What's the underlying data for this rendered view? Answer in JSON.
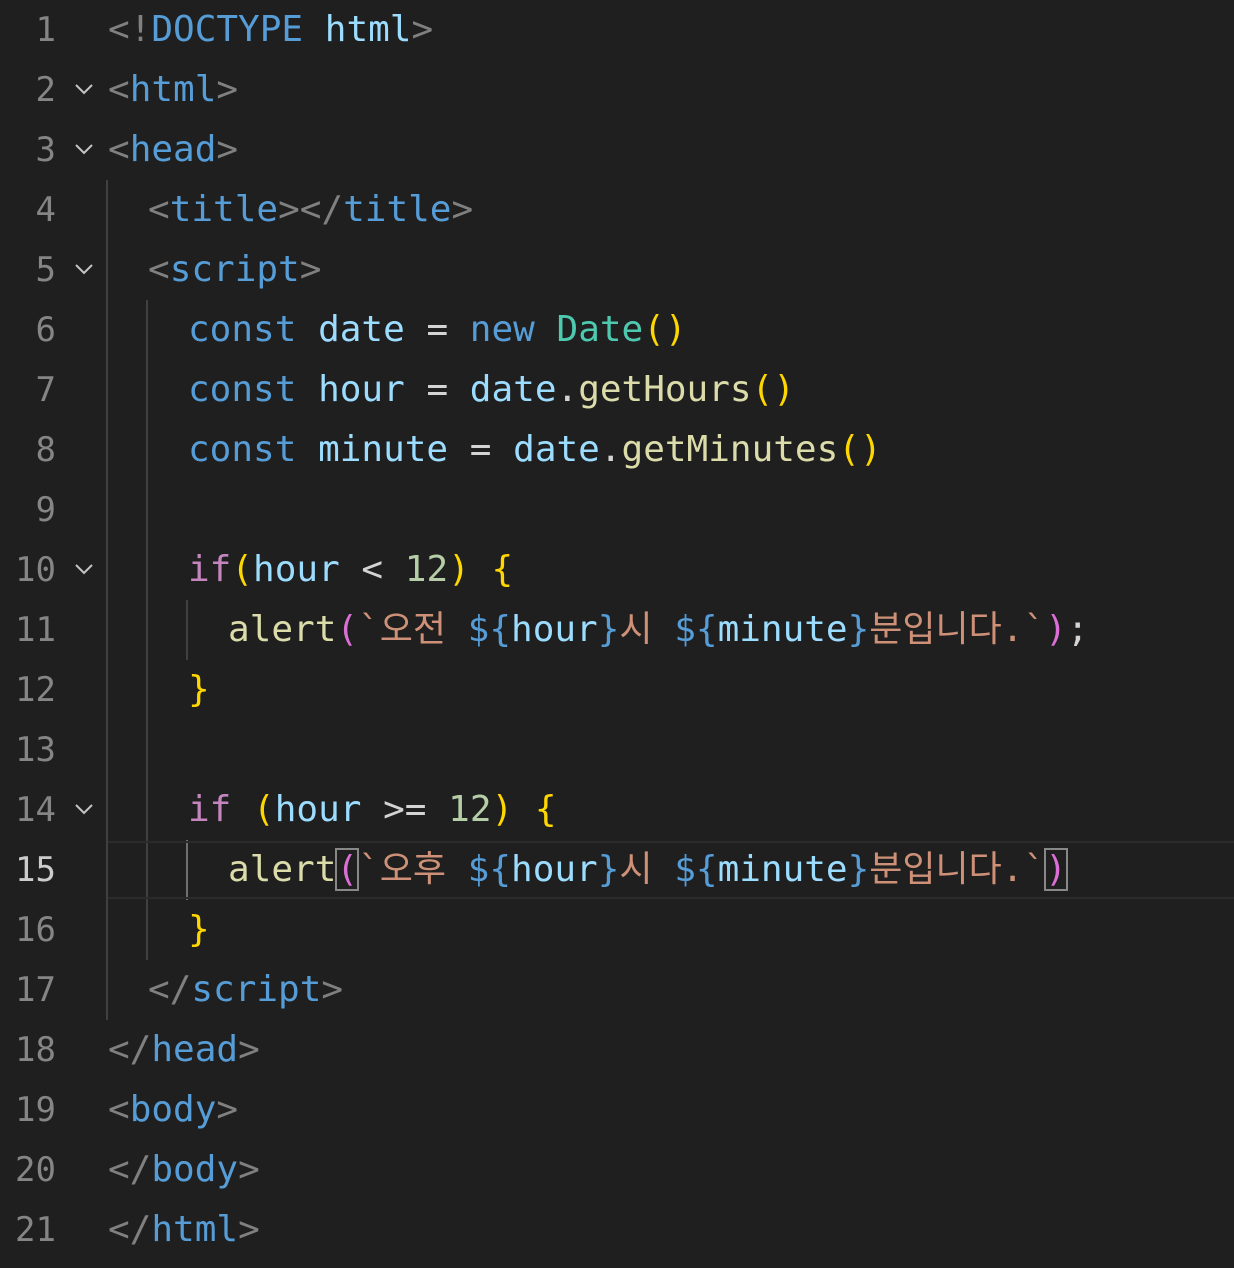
{
  "editor": {
    "active_line": 15,
    "lines": [
      {
        "number": "1",
        "tokens": [
          {
            "t": "<!",
            "c": "pun"
          },
          {
            "t": "DOCTYPE",
            "c": "tag"
          },
          {
            "t": " ",
            "c": "txt"
          },
          {
            "t": "html",
            "c": "attr"
          },
          {
            "t": ">",
            "c": "pun"
          }
        ]
      },
      {
        "number": "2",
        "tokens": [
          {
            "t": "<",
            "c": "pun"
          },
          {
            "t": "html",
            "c": "tag"
          },
          {
            "t": ">",
            "c": "pun"
          }
        ]
      },
      {
        "number": "3",
        "tokens": [
          {
            "t": "<",
            "c": "pun"
          },
          {
            "t": "head",
            "c": "tag"
          },
          {
            "t": ">",
            "c": "pun"
          }
        ]
      },
      {
        "number": "4",
        "tokens": [
          {
            "t": "<",
            "c": "pun"
          },
          {
            "t": "title",
            "c": "tag"
          },
          {
            "t": "></",
            "c": "pun"
          },
          {
            "t": "title",
            "c": "tag"
          },
          {
            "t": ">",
            "c": "pun"
          }
        ]
      },
      {
        "number": "5",
        "tokens": [
          {
            "t": "<",
            "c": "pun"
          },
          {
            "t": "script",
            "c": "tag"
          },
          {
            "t": ">",
            "c": "pun"
          }
        ]
      },
      {
        "number": "6",
        "tokens": [
          {
            "t": "const",
            "c": "kw"
          },
          {
            "t": " ",
            "c": "txt"
          },
          {
            "t": "date",
            "c": "var"
          },
          {
            "t": " = ",
            "c": "txt"
          },
          {
            "t": "new",
            "c": "kw"
          },
          {
            "t": " ",
            "c": "txt"
          },
          {
            "t": "Date",
            "c": "cls"
          },
          {
            "t": "()",
            "c": "br1"
          }
        ]
      },
      {
        "number": "7",
        "tokens": [
          {
            "t": "const",
            "c": "kw"
          },
          {
            "t": " ",
            "c": "txt"
          },
          {
            "t": "hour",
            "c": "var"
          },
          {
            "t": " = ",
            "c": "txt"
          },
          {
            "t": "date",
            "c": "var"
          },
          {
            "t": ".",
            "c": "txt"
          },
          {
            "t": "getHours",
            "c": "fn"
          },
          {
            "t": "()",
            "c": "br1"
          }
        ]
      },
      {
        "number": "8",
        "tokens": [
          {
            "t": "const",
            "c": "kw"
          },
          {
            "t": " ",
            "c": "txt"
          },
          {
            "t": "minute",
            "c": "var"
          },
          {
            "t": " = ",
            "c": "txt"
          },
          {
            "t": "date",
            "c": "var"
          },
          {
            "t": ".",
            "c": "txt"
          },
          {
            "t": "getMinutes",
            "c": "fn"
          },
          {
            "t": "()",
            "c": "br1"
          }
        ]
      },
      {
        "number": "9",
        "tokens": []
      },
      {
        "number": "10",
        "tokens": [
          {
            "t": "if",
            "c": "ctl"
          },
          {
            "t": "(",
            "c": "br1"
          },
          {
            "t": "hour",
            "c": "var"
          },
          {
            "t": " < ",
            "c": "txt"
          },
          {
            "t": "12",
            "c": "num"
          },
          {
            "t": ")",
            "c": "br1"
          },
          {
            "t": " ",
            "c": "txt"
          },
          {
            "t": "{",
            "c": "br1"
          }
        ]
      },
      {
        "number": "11",
        "tokens": [
          {
            "t": "alert",
            "c": "fn"
          },
          {
            "t": "(",
            "c": "br2"
          },
          {
            "t": "`오전 ",
            "c": "str"
          },
          {
            "t": "${",
            "c": "tpl"
          },
          {
            "t": "hour",
            "c": "var"
          },
          {
            "t": "}",
            "c": "tpl"
          },
          {
            "t": "시 ",
            "c": "str"
          },
          {
            "t": "${",
            "c": "tpl"
          },
          {
            "t": "minute",
            "c": "var"
          },
          {
            "t": "}",
            "c": "tpl"
          },
          {
            "t": "분입니다.`",
            "c": "str"
          },
          {
            "t": ")",
            "c": "br2"
          },
          {
            "t": ";",
            "c": "txt"
          }
        ]
      },
      {
        "number": "12",
        "tokens": [
          {
            "t": "}",
            "c": "br1"
          }
        ]
      },
      {
        "number": "13",
        "tokens": []
      },
      {
        "number": "14",
        "tokens": [
          {
            "t": "if",
            "c": "ctl"
          },
          {
            "t": " ",
            "c": "txt"
          },
          {
            "t": "(",
            "c": "br1"
          },
          {
            "t": "hour",
            "c": "var"
          },
          {
            "t": " >= ",
            "c": "txt"
          },
          {
            "t": "12",
            "c": "num"
          },
          {
            "t": ")",
            "c": "br1"
          },
          {
            "t": " ",
            "c": "txt"
          },
          {
            "t": "{",
            "c": "br1"
          }
        ]
      },
      {
        "number": "15",
        "tokens": [
          {
            "t": "alert",
            "c": "fn"
          },
          {
            "t": "(",
            "c": "br2 bm"
          },
          {
            "t": "`오후 ",
            "c": "str"
          },
          {
            "t": "${",
            "c": "tpl"
          },
          {
            "t": "hour",
            "c": "var"
          },
          {
            "t": "}",
            "c": "tpl"
          },
          {
            "t": "시 ",
            "c": "str"
          },
          {
            "t": "${",
            "c": "tpl"
          },
          {
            "t": "minute",
            "c": "var"
          },
          {
            "t": "}",
            "c": "tpl"
          },
          {
            "t": "분입니다.`",
            "c": "str"
          },
          {
            "t": ")",
            "c": "br2 bm"
          }
        ]
      },
      {
        "number": "16",
        "tokens": [
          {
            "t": "}",
            "c": "br1"
          }
        ]
      },
      {
        "number": "17",
        "tokens": [
          {
            "t": "</",
            "c": "pun"
          },
          {
            "t": "script",
            "c": "tag"
          },
          {
            "t": ">",
            "c": "pun"
          }
        ]
      },
      {
        "number": "18",
        "tokens": [
          {
            "t": "</",
            "c": "pun"
          },
          {
            "t": "head",
            "c": "tag"
          },
          {
            "t": ">",
            "c": "pun"
          }
        ]
      },
      {
        "number": "19",
        "tokens": [
          {
            "t": "<",
            "c": "pun"
          },
          {
            "t": "body",
            "c": "tag"
          },
          {
            "t": ">",
            "c": "pun"
          }
        ]
      },
      {
        "number": "20",
        "tokens": [
          {
            "t": "</",
            "c": "pun"
          },
          {
            "t": "body",
            "c": "tag"
          },
          {
            "t": ">",
            "c": "pun"
          }
        ]
      },
      {
        "number": "21",
        "tokens": [
          {
            "t": "</",
            "c": "pun"
          },
          {
            "t": "html",
            "c": "tag"
          },
          {
            "t": ">",
            "c": "pun"
          }
        ]
      }
    ]
  },
  "icons": {
    "fold": "chevron-down-icon"
  },
  "colors": {
    "background": "#1f1f1f",
    "line_number": "#858585",
    "line_number_active": "#cccccc",
    "tag": "#569cd6",
    "keyword": "#569cd6",
    "control": "#c586c0",
    "variable": "#9cdcfe",
    "class": "#4ec9b0",
    "function": "#dcdcaa",
    "number": "#b5cea8",
    "string": "#ce9178",
    "bracket_level1": "#ffd700",
    "bracket_level2": "#da70d6"
  }
}
